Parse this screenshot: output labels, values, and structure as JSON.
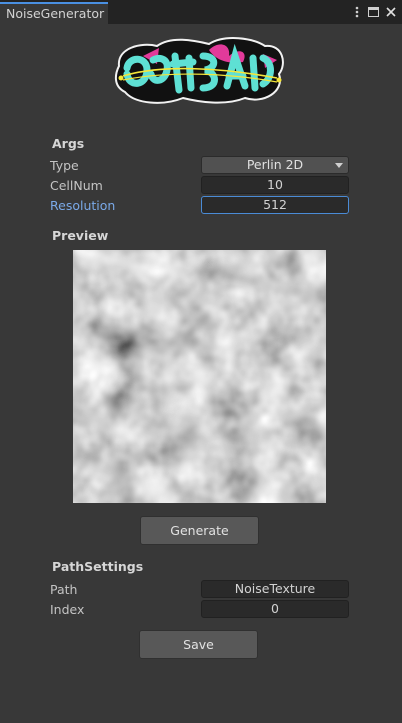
{
  "window": {
    "tab_title": "NoiseGenerator"
  },
  "args": {
    "title": "Args",
    "type_label": "Type",
    "type_value": "Perlin 2D",
    "cellnum_label": "CellNum",
    "cellnum_value": "10",
    "resolution_label": "Resolution",
    "resolution_value": "512"
  },
  "preview": {
    "title": "Preview"
  },
  "generate_label": "Generate",
  "path_settings": {
    "title": "PathSettings",
    "path_label": "Path",
    "path_value": "NoiseTexture",
    "index_label": "Index",
    "index_value": "0"
  },
  "save_label": "Save",
  "colors": {
    "accent": "#4a90e2",
    "active_label": "#7aa9e8",
    "panel_bg": "#383838"
  },
  "icons": [
    "kebab-menu-icon",
    "maximize-icon",
    "close-icon",
    "graffiti-logo",
    "dropdown-arrow-icon"
  ]
}
